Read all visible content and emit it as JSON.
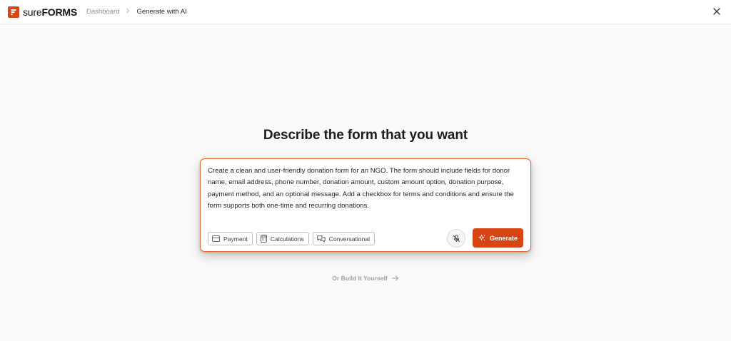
{
  "app": {
    "logo_text_light": "sure",
    "logo_text_bold": "FORMS",
    "logo_icon": "sureforms-logo-icon"
  },
  "breadcrumb": {
    "items": [
      {
        "label": "Dashboard"
      },
      {
        "label": "Generate with AI"
      }
    ],
    "separator_icon": "chevron-right-icon"
  },
  "header": {
    "close_icon": "close-icon"
  },
  "main": {
    "title": "Describe the form that you want",
    "prompt": {
      "value": "Create a clean and user-friendly donation form for an NGO. The form should include fields for donor name, email address, phone number, donation amount, custom amount option, donation purpose, payment method, and an optional message. Add a checkbox for terms and conditions and ensure the form supports both one-time and recurring donations."
    },
    "chips": [
      {
        "label": "Payment",
        "icon": "credit-card-icon"
      },
      {
        "label": "Calculations",
        "icon": "calculator-icon"
      },
      {
        "label": "Conversational",
        "icon": "chat-bubbles-icon"
      }
    ],
    "mic_icon": "microphone-off-icon",
    "generate_label": "Generate",
    "generate_icon": "sparkles-icon",
    "build_yourself_label": "Or Build It Yourself",
    "build_yourself_icon": "arrow-right-icon"
  },
  "colors": {
    "accent": "#d74515",
    "focus_border": "#e4662f",
    "background": "#f9f9fa"
  }
}
